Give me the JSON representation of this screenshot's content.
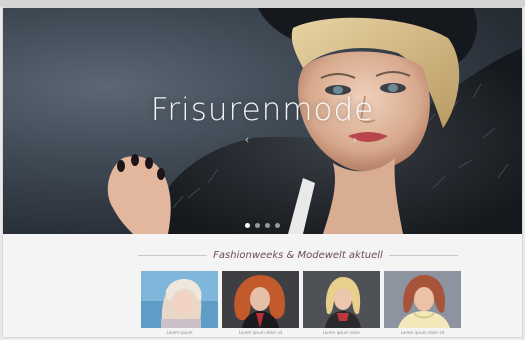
{
  "hero": {
    "title": "Frisurenmode",
    "prev_arrow": "‹",
    "next_arrow": "›",
    "slide_count": 4,
    "active_slide": 1
  },
  "section": {
    "title": "Fashionweeks & Modewelt aktuell"
  },
  "thumbnails": [
    {
      "caption": "Lorem ipsum"
    },
    {
      "caption": "Lorem ipsum dolor sit"
    },
    {
      "caption": "Lorem ipsum dolor"
    },
    {
      "caption": "Lorem ipsum dolor sit"
    }
  ],
  "colors": {
    "section_title": "#6a4b58",
    "hero_background": "#2b333c"
  }
}
